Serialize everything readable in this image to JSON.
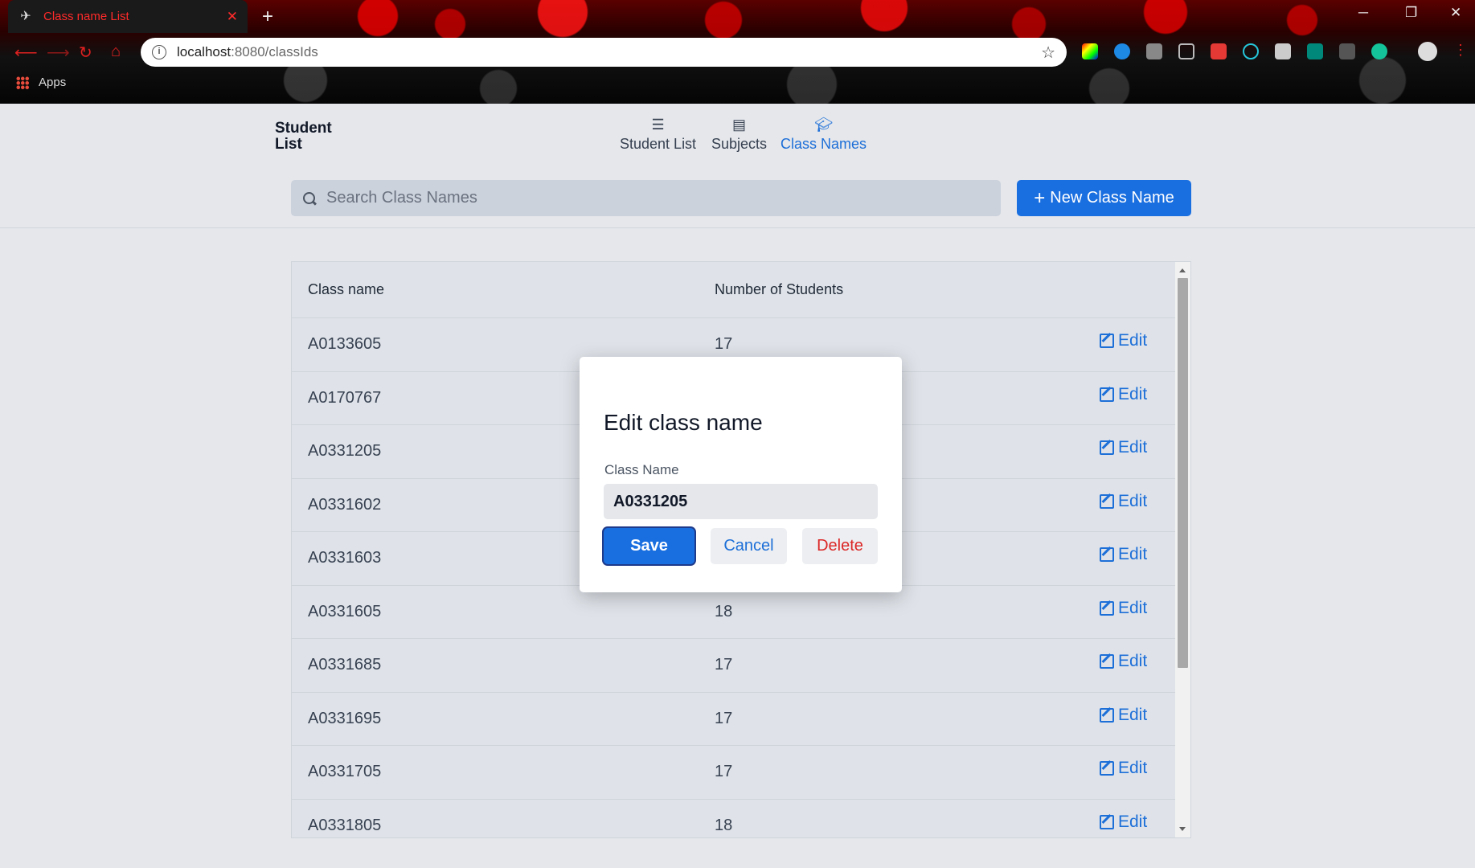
{
  "browser": {
    "tab_title": "Class name List",
    "tab_close": "✕",
    "new_tab": "+",
    "url_host": "localhost",
    "url_path": ":8080/classIds",
    "bookmarks_apps": "Apps",
    "win_minimize": "─",
    "win_restore": "❐",
    "win_close": "✕"
  },
  "header": {
    "brand": "Student List",
    "nav": [
      {
        "label": "Student List",
        "icon": "list-icon",
        "active": false
      },
      {
        "label": "Subjects",
        "icon": "book-icon",
        "active": false
      },
      {
        "label": "Class Names",
        "icon": "graduation-cap-icon",
        "active": true
      }
    ],
    "search_placeholder": "Search Class Names",
    "new_button_label": "New Class Name",
    "new_button_plus": "+"
  },
  "table": {
    "columns": [
      "Class name",
      "Number of Students"
    ],
    "edit_label": "Edit",
    "rows": [
      {
        "name": "A0133605",
        "count": "17"
      },
      {
        "name": "A0170767",
        "count": ""
      },
      {
        "name": "A0331205",
        "count": ""
      },
      {
        "name": "A0331602",
        "count": ""
      },
      {
        "name": "A0331603",
        "count": ""
      },
      {
        "name": "A0331605",
        "count": "18"
      },
      {
        "name": "A0331685",
        "count": "17"
      },
      {
        "name": "A0331695",
        "count": "17"
      },
      {
        "name": "A0331705",
        "count": "17"
      },
      {
        "name": "A0331805",
        "count": "18"
      }
    ]
  },
  "modal": {
    "title": "Edit class name",
    "label": "Class Name",
    "value": "A0331205",
    "save": "Save",
    "cancel": "Cancel",
    "delete": "Delete"
  },
  "colors": {
    "accent": "#1a6fe0",
    "danger": "#dc2626",
    "tab_text": "#ff2a2a"
  }
}
